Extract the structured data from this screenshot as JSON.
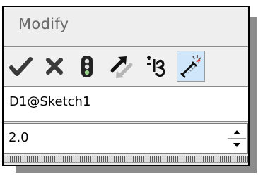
{
  "dialog": {
    "title": "Modify",
    "dimension_name": "D1@Sketch1",
    "value": "2.0"
  },
  "toolbar": {
    "buttons": [
      {
        "icon": "checkmark-icon",
        "color": "#3a3a3a"
      },
      {
        "icon": "close-x-icon",
        "color": "#3a3a3a"
      },
      {
        "icon": "rebuild-traffic-light-icon",
        "color": "#222222"
      },
      {
        "icon": "reset-arrows-icon",
        "color": "#111111"
      },
      {
        "icon": "reverse-dimension-icon",
        "color": "#111111"
      },
      {
        "icon": "mark-dimension-import-icon",
        "color": "#111111",
        "active": true
      }
    ]
  },
  "spinner": {
    "up_icon": "spinner-up-icon",
    "down_icon": "spinner-down-icon"
  },
  "colors": {
    "active_button": "#cfe6fb",
    "title_bg": "#eeeeee",
    "shadow": "#8c8c8c"
  }
}
